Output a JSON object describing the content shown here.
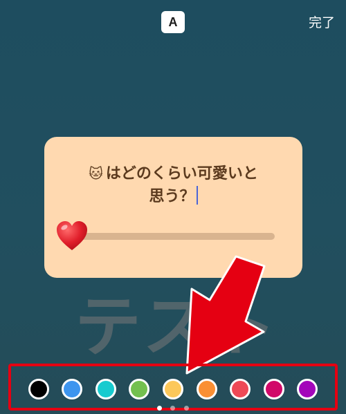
{
  "toolbar": {
    "font_button_label": "A",
    "done_label": "完了"
  },
  "background_text": "テスト",
  "sticker": {
    "emoji": "🐱",
    "question_line1": "はどのくらい可愛いと",
    "question_line2": "思う？",
    "slider_emoji": "heart-icon",
    "colors": {
      "sticker_bg": "#ffd9b0",
      "text": "#5b3a1e",
      "track": "#d9b48f"
    }
  },
  "palette": {
    "swatches": [
      {
        "name": "black",
        "color": "#000000"
      },
      {
        "name": "blue",
        "color": "#3d95ef"
      },
      {
        "name": "cyan",
        "color": "#17cbcf"
      },
      {
        "name": "green",
        "color": "#73c04f"
      },
      {
        "name": "yellow",
        "color": "#fcc85a"
      },
      {
        "name": "orange",
        "color": "#fa8f33"
      },
      {
        "name": "red",
        "color": "#ee4956"
      },
      {
        "name": "magenta",
        "color": "#d10869"
      },
      {
        "name": "purple",
        "color": "#a306ba"
      }
    ],
    "page_count": 3,
    "current_page": 1
  },
  "annotation": {
    "arrow_color": "#e50012",
    "highlight_color": "#e50012"
  }
}
